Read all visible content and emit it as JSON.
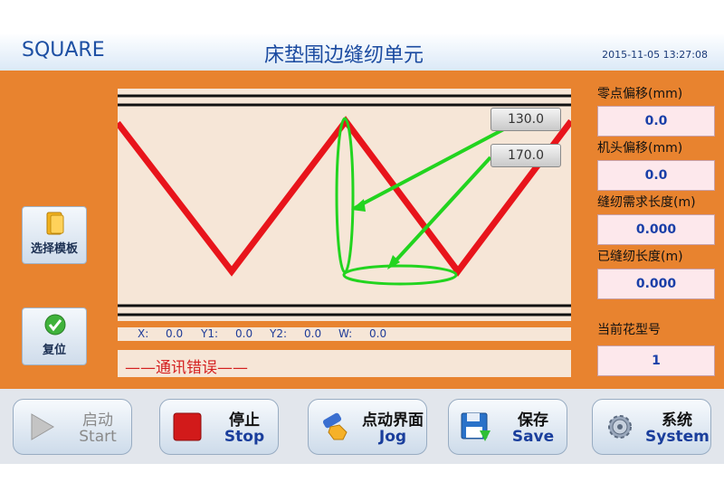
{
  "header": {
    "brand": "SQUARE",
    "title": "床垫围边缝纫单元",
    "datetime": "2015-11-05 13:27:08"
  },
  "sidebar": {
    "select_template": "选择模板",
    "reset": "复位"
  },
  "sewing_area": {
    "tag_a": "130.0",
    "tag_b": "170.0"
  },
  "coords": {
    "x_label": "X:",
    "x_value": "0.0",
    "y1_label": "Y1:",
    "y1_value": "0.0",
    "y2_label": "Y2:",
    "y2_value": "0.0",
    "w_label": "W:",
    "w_value": "0.0"
  },
  "status": {
    "message": "——通讯错误——"
  },
  "right_panel": {
    "zero_offset_label": "零点偏移(mm)",
    "zero_offset_value": "0.0",
    "head_offset_label": "机头偏移(mm)",
    "head_offset_value": "0.0",
    "required_length_label": "缝纫需求长度(m)",
    "required_length_value": "0.000",
    "sewn_length_label": "已缝纫长度(m)",
    "sewn_length_value": "0.000",
    "pattern_label": "当前花型号",
    "pattern_value": "1"
  },
  "toolbar": {
    "start_cn": "启动",
    "start_en": "Start",
    "stop_cn": "停止",
    "stop_en": "Stop",
    "jog_cn": "点动界面",
    "jog_en": "Jog",
    "save_cn": "保存",
    "save_en": "Save",
    "system_cn": "系统",
    "system_en": "System"
  },
  "colors": {
    "panel": "#e8832f",
    "header_text": "#1a4aa0",
    "stitch_line": "#e8141b",
    "guide": "#22d41f",
    "error_text": "#d42020"
  }
}
